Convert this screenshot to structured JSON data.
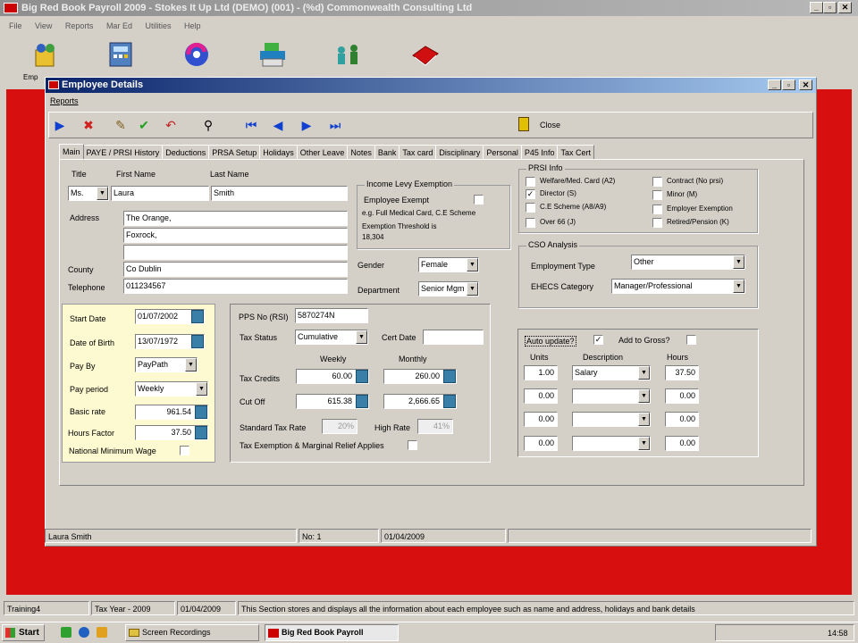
{
  "app": {
    "title": "Big Red Book Payroll 2009 - Stokes It Up Ltd (DEMO) (001) - (%d) Commonwealth Consulting Ltd",
    "menu": [
      "File",
      "View",
      "Reports",
      "Mar Ed",
      "Utilities",
      "Help"
    ],
    "toolbar_first_label": "Emp"
  },
  "window": {
    "title": "Employee Details",
    "menu": "Reports",
    "close_label": "Close"
  },
  "tabs": [
    "Main",
    "PAYE / PRSI History",
    "Deductions",
    "PRSA Setup",
    "Holidays",
    "Other Leave",
    "Notes",
    "Bank",
    "Tax card",
    "Disciplinary",
    "Personal",
    "P45 Info",
    "Tax Cert"
  ],
  "personal": {
    "title_label": "Title",
    "first_name_label": "First Name",
    "last_name_label": "Last Name",
    "title": "Ms.",
    "first_name": "Laura",
    "last_name": "Smith",
    "address_label": "Address",
    "address1": "The Orange,",
    "address2": "Foxrock,",
    "address3": "",
    "address4": "",
    "county_label": "County",
    "county": "Co Dublin",
    "telephone_label": "Telephone",
    "telephone": "011234567"
  },
  "levy": {
    "caption": "Income Levy Exemption",
    "exempt_label": "Employee Exempt",
    "eg": "e.g. Full Medical Card, C.E Scheme",
    "threshold_label": "Exemption Threshold is",
    "threshold": "18,304"
  },
  "gender": {
    "label": "Gender",
    "value": "Female"
  },
  "department": {
    "label": "Department",
    "value": "Senior Mgm"
  },
  "prsi": {
    "caption": "PRSI Info",
    "items": [
      {
        "label": "Welfare/Med. Card (A2)",
        "checked": false
      },
      {
        "label": "Director (S)",
        "checked": true
      },
      {
        "label": "C.E Scheme (A8/A9)",
        "checked": false
      },
      {
        "label": "Over 66 (J)",
        "checked": false
      },
      {
        "label": "Contract (No prsi)",
        "checked": false
      },
      {
        "label": "Minor (M)",
        "checked": false
      },
      {
        "label": "Employer Exemption",
        "checked": false
      },
      {
        "label": "Retired/Pension (K)",
        "checked": false
      }
    ]
  },
  "cso": {
    "caption": "CSO Analysis",
    "employment_type_label": "Employment Type",
    "employment_type": "Other",
    "ehecs_label": "EHECS Category",
    "ehecs": "Manager/Professional"
  },
  "pay": {
    "start_date_label": "Start Date",
    "start_date": "01/07/2002",
    "dob_label": "Date of Birth",
    "dob": "13/07/1972",
    "pay_by_label": "Pay By",
    "pay_by": "PayPath",
    "pay_period_label": "Pay period",
    "pay_period": "Weekly",
    "basic_rate_label": "Basic rate",
    "basic_rate": "961.54",
    "hours_factor_label": "Hours Factor",
    "hours_factor": "37.50",
    "nmw_label": "National Minimum Wage"
  },
  "tax": {
    "pps_label": "PPS No (RSI)",
    "pps": "5870274N",
    "status_label": "Tax Status",
    "status": "Cumulative",
    "cert_date_label": "Cert Date",
    "cert_date": "",
    "weekly_label": "Weekly",
    "monthly_label": "Monthly",
    "credits_label": "Tax Credits",
    "credits_weekly": "60.00",
    "credits_monthly": "260.00",
    "cutoff_label": "Cut Off",
    "cutoff_weekly": "615.38",
    "cutoff_monthly": "2,666.65",
    "std_rate_label": "Standard Tax Rate",
    "std_rate": "20%",
    "high_rate_label": "High Rate",
    "high_rate": "41%",
    "exemption_label": "Tax Exemption & Marginal Relief Applies"
  },
  "auto": {
    "update_label": "Auto update?",
    "update_checked": true,
    "add_gross_label": "Add to Gross?",
    "units_label": "Units",
    "desc_label": "Description",
    "hours_label": "Hours",
    "rows": [
      {
        "units": "1.00",
        "desc": "Salary",
        "hours": "37.50"
      },
      {
        "units": "0.00",
        "desc": "",
        "hours": "0.00"
      },
      {
        "units": "0.00",
        "desc": "",
        "hours": "0.00"
      },
      {
        "units": "0.00",
        "desc": "",
        "hours": "0.00"
      }
    ]
  },
  "inner_status": {
    "name": "Laura Smith",
    "no": "No: 1",
    "date": "01/04/2009"
  },
  "status": {
    "training": "Training4",
    "tax_year": "Tax Year - 2009",
    "date": "01/04/2009",
    "message": "This Section stores and displays all the information about each employee such as name and address, holidays and bank details"
  },
  "taskbar": {
    "start": "Start",
    "tasks": [
      "Screen Recordings",
      "Big Red Book Payroll"
    ],
    "clock": "14:58"
  }
}
